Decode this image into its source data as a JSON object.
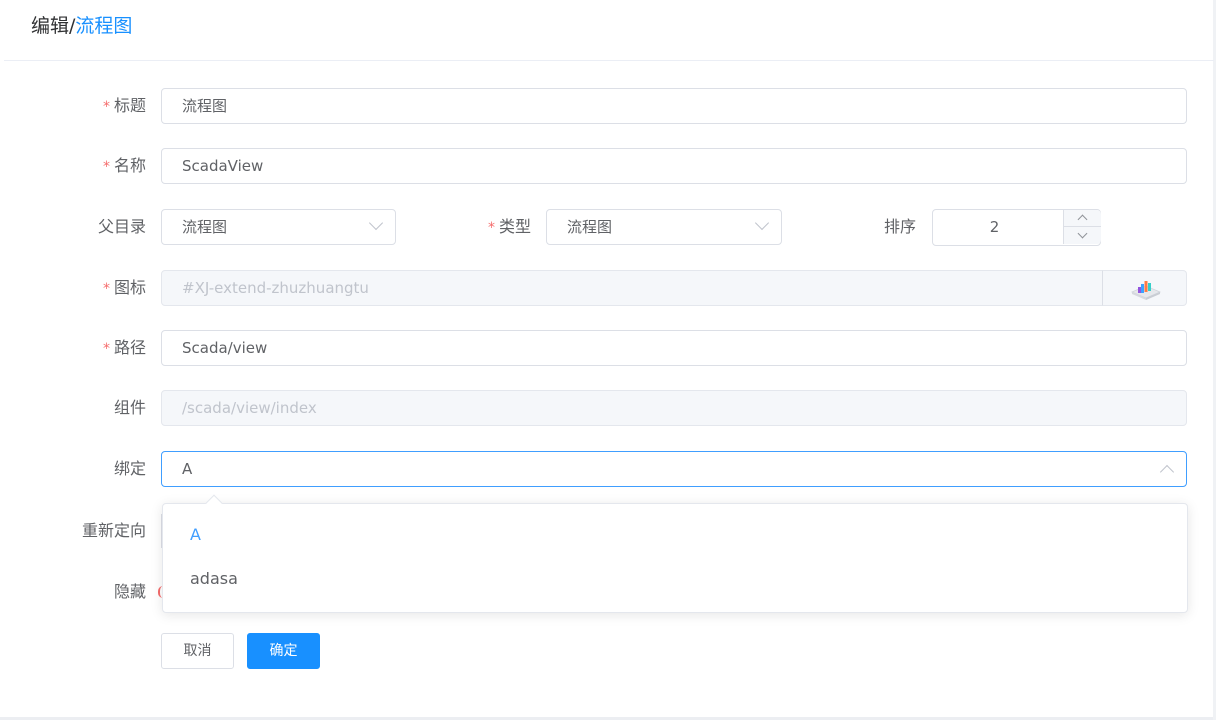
{
  "header": {
    "prefix": "编辑/",
    "current": "流程图"
  },
  "form": {
    "title": {
      "label": "标题",
      "value": "流程图",
      "required": true
    },
    "name": {
      "label": "名称",
      "value": "ScadaView",
      "required": true
    },
    "parent": {
      "label": "父目录",
      "value": "流程图"
    },
    "type": {
      "label": "类型",
      "value": "流程图",
      "required": true
    },
    "sort": {
      "label": "排序",
      "value": "2"
    },
    "icon": {
      "label": "图标",
      "value": "#XJ-extend-zhuzhuangtu",
      "required": true,
      "icon_name": "bar-chart-3d-icon"
    },
    "path": {
      "label": "路径",
      "value": "Scada/view",
      "required": true
    },
    "component": {
      "label": "组件",
      "value": "/scada/view/index"
    },
    "bind": {
      "label": "绑定",
      "value": "A"
    },
    "redirect": {
      "label": "重新定向"
    },
    "hidden": {
      "label": "隐藏"
    }
  },
  "dropdown": {
    "options": [
      "A",
      "adasa"
    ],
    "selected": "A"
  },
  "actions": {
    "cancel": "取消",
    "ok": "确定"
  },
  "colors": {
    "accent": "#1890ff",
    "required": "#f56c6c"
  }
}
